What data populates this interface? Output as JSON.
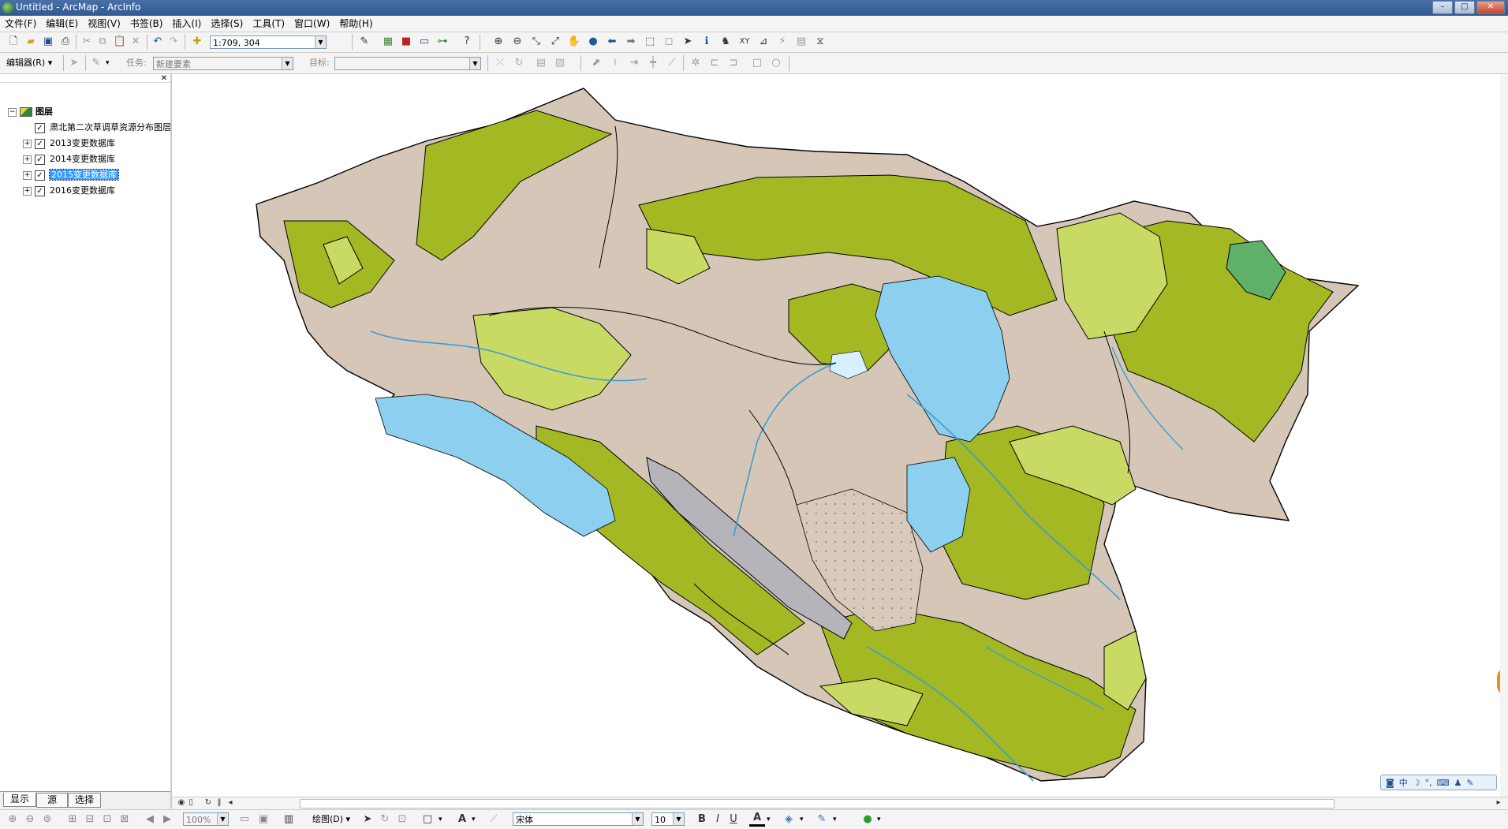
{
  "window": {
    "title": "Untitled - ArcMap - ArcInfo"
  },
  "menu": [
    "文件(F)",
    "编辑(E)",
    "视图(V)",
    "书签(B)",
    "插入(I)",
    "选择(S)",
    "工具(T)",
    "窗口(W)",
    "帮助(H)"
  ],
  "toolbar": {
    "scale_value": "1:709, 304",
    "editor_label": "编辑器(R)",
    "task_label": "任务:",
    "task_value": "新建要素",
    "target_label": "目标:",
    "target_value": ""
  },
  "toc": {
    "root_label": "图层",
    "layers": [
      {
        "name": "肃北第二次草调草资源分布图层",
        "checked": true,
        "expandable": false,
        "selected": false
      },
      {
        "name": "2013变更数据库",
        "checked": true,
        "expandable": true,
        "selected": false
      },
      {
        "name": "2014变更数据库",
        "checked": true,
        "expandable": true,
        "selected": false
      },
      {
        "name": "2015变更数据库",
        "checked": true,
        "expandable": true,
        "selected": true
      },
      {
        "name": "2016变更数据库",
        "checked": true,
        "expandable": true,
        "selected": false
      }
    ],
    "tabs": [
      "显示",
      "源",
      "选择"
    ]
  },
  "drawing": {
    "draw_label": "绘图(D)",
    "zoom_value": "100%",
    "font_name": "宋体",
    "font_size": "10",
    "bold": "B",
    "italic": "I",
    "underline": "U"
  },
  "ime": {
    "label": "中"
  },
  "colors": {
    "desert": "#d5c6b8",
    "grass_dark": "#a3b822",
    "grass_light": "#c8da63",
    "water": "#8ccfee",
    "forest": "#5fb069",
    "rock": "#b5b4bb",
    "selection": "#3399ff"
  }
}
